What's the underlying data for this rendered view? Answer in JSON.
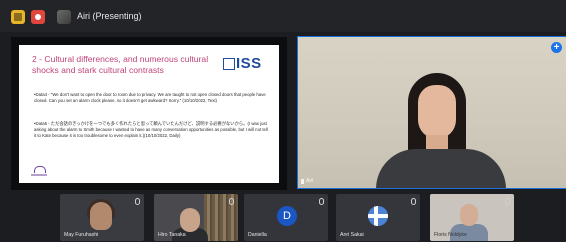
{
  "top_bar": {
    "presenter_label": "Airi (Presenting)"
  },
  "slide": {
    "title": "2 - Cultural differences, and numerous cultural shocks and stark cultural contrasts",
    "logo_text": "ISS",
    "paragraphs": [
      "•Data4 - \"We don't want to open the door to room due to privacy. We are taught to not open closed doors that people have closed. Can you set an alarm clock please, so it doesn't get awkward? Sorry.\" (10/10/2022, Text)",
      "•Data5 - ただ会話のきっかけを一つでも多く作れたらと思って頼んでいたんだけど、説明する必要がないから。(I was just asking about the alarm to Smith because I wanted to have as many conversation opportunities as possible, but I will not tell it to Kate because it is too troublesome to even explain it.)(10/10/2022, Daily)"
    ]
  },
  "speaker": {
    "name": "Airi"
  },
  "participants": [
    {
      "name": "May Furuhashi"
    },
    {
      "name": "Hiro Tanaka"
    },
    {
      "name": "Daniella",
      "initial": "D"
    },
    {
      "name": "Anri Sakai"
    },
    {
      "name": "Floris Noldyke"
    }
  ],
  "colors": {
    "slide_title": "#c0447a",
    "iss_logo": "#1e4b9a",
    "active_border": "#1a6fd8",
    "avatar_blue": "#1b57c4"
  }
}
